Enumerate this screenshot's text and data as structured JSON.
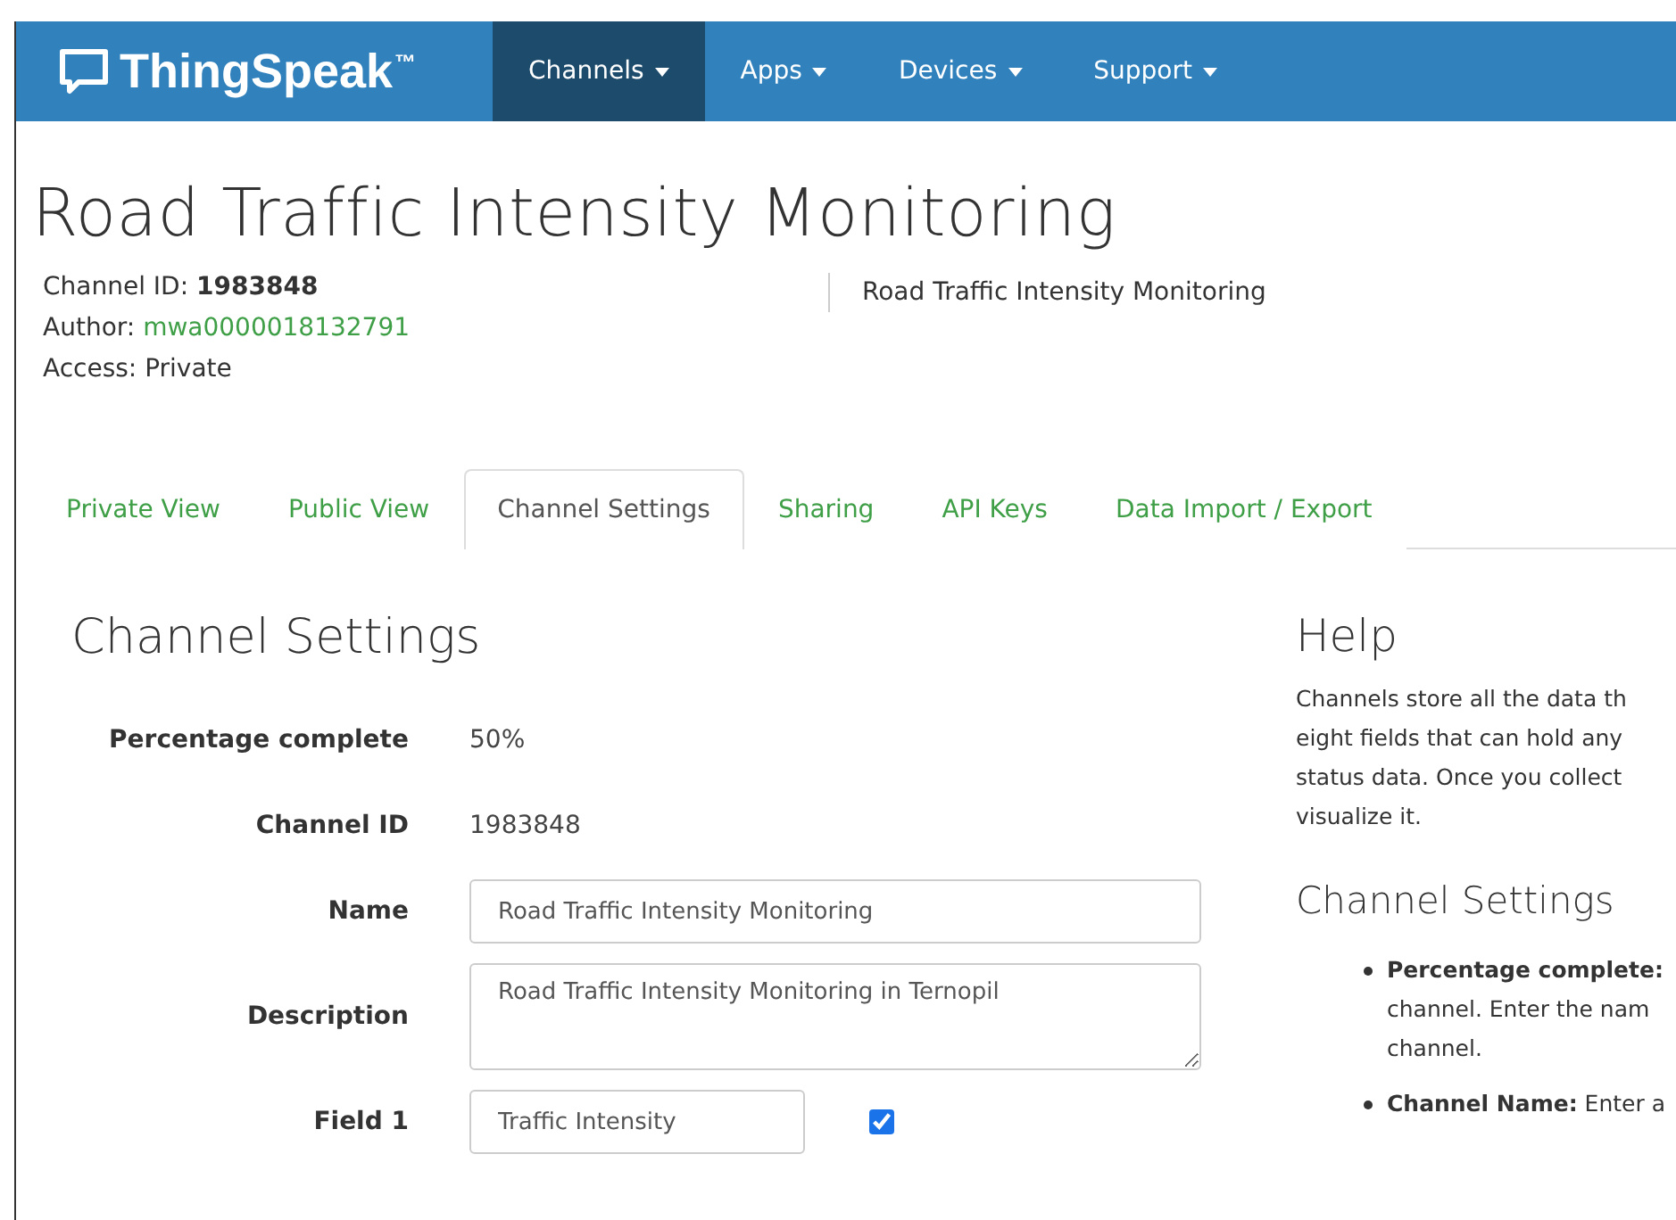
{
  "navbar": {
    "brand": "ThingSpeak",
    "trademark": "™",
    "items": [
      {
        "label": "Channels",
        "selected": true
      },
      {
        "label": "Apps",
        "selected": false
      },
      {
        "label": "Devices",
        "selected": false
      },
      {
        "label": "Support",
        "selected": false
      }
    ]
  },
  "title": "Road Traffic Intensity Monitoring",
  "info": {
    "channel_id_label": "Channel ID:",
    "channel_id": "1983848",
    "author_label": "Author:",
    "author": "mwa0000018132791",
    "access": "Access: Private",
    "description": "Road Traffic Intensity Monitoring"
  },
  "tabs": [
    {
      "label": "Private View",
      "selected": false
    },
    {
      "label": "Public View",
      "selected": false
    },
    {
      "label": "Channel Settings",
      "selected": true
    },
    {
      "label": "Sharing",
      "selected": false
    },
    {
      "label": "API Keys",
      "selected": false
    },
    {
      "label": "Data Import / Export",
      "selected": false
    }
  ],
  "settings": {
    "heading": "Channel Settings",
    "rows": [
      {
        "kind": "text",
        "label": "Percentage complete",
        "value": "50%"
      },
      {
        "kind": "text",
        "label": "Channel ID",
        "value": "1983848"
      },
      {
        "kind": "input",
        "label": "Name",
        "value": "Road Traffic Intensity Monitoring"
      },
      {
        "kind": "textarea",
        "label": "Description",
        "value": "Road Traffic Intensity Monitoring in Ternopil"
      },
      {
        "kind": "field",
        "label": "Field 1",
        "value": "Traffic Intensity",
        "checked": true
      }
    ]
  },
  "help": {
    "heading": "Help",
    "lines": [
      "Channels store all the data th",
      "eight fields that can hold any",
      "status data. Once you collect",
      "visualize it."
    ],
    "subheading": "Channel Settings",
    "bullets": [
      {
        "lines": [
          "**Percentage complete:**",
          "channel. Enter the nam",
          "channel."
        ]
      },
      {
        "lines": [
          "**Channel Name:** Enter a"
        ]
      }
    ]
  }
}
